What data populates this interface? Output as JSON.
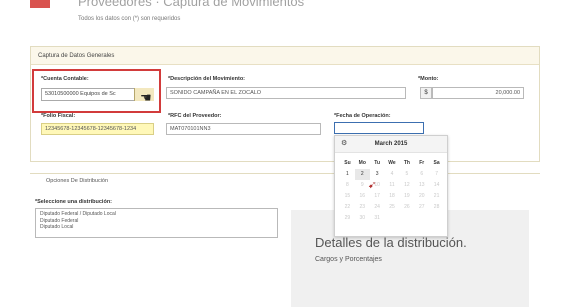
{
  "header": {
    "title": "Proveedores · Captura de Movimientos",
    "subtitle": "Todos los datos con (*) son requeridos"
  },
  "section_general": {
    "title": "Captura de Datos Generales",
    "cuenta_contable": {
      "label": "*Cuenta Contable:",
      "value": "53010500000 Equipos de Sc"
    },
    "descripcion": {
      "label": "*Descripción del Movimiento:",
      "value": "SONIDO CAMPAÑA EN EL ZOCALO"
    },
    "monto": {
      "label": "*Monto:",
      "currency": "$",
      "value": "20,000.00"
    },
    "folio_fiscal": {
      "label": "*Folio Fiscal:",
      "value": "12345678-12345678-12345678-1234"
    },
    "rfc": {
      "label": "*RFC del Proveedor:",
      "value": "MAT070101NN3"
    },
    "fecha": {
      "label": "*Fecha de Operación:",
      "value": ""
    }
  },
  "datepicker": {
    "prev_icon": "⚙",
    "title": "March 2015",
    "weekdays": [
      "Su",
      "Mo",
      "Tu",
      "We",
      "Th",
      "Fr",
      "Sa"
    ],
    "weeks": [
      [
        "1",
        "2",
        "3",
        "4",
        "5",
        "6",
        "7"
      ],
      [
        "8",
        "9",
        "10",
        "11",
        "12",
        "13",
        "14"
      ],
      [
        "15",
        "16",
        "17",
        "18",
        "19",
        "20",
        "21"
      ],
      [
        "22",
        "23",
        "24",
        "25",
        "26",
        "27",
        "28"
      ],
      [
        "29",
        "30",
        "31",
        "",
        "",
        "",
        ""
      ]
    ]
  },
  "section_distribution": {
    "title": "Opciones De Distribución",
    "select_label": "*Seleccione una distribución:",
    "options": [
      "Diputado Federal / Diputado Local",
      "Diputado Federal",
      "Diputado Local"
    ]
  },
  "details": {
    "title": "Detalles de la distribución.",
    "subtitle": "Cargos y Porcentajes"
  },
  "colors": {
    "accent": "#d9534f",
    "highlight_border": "#d23b3b",
    "folio_background": "#fff8b8"
  }
}
